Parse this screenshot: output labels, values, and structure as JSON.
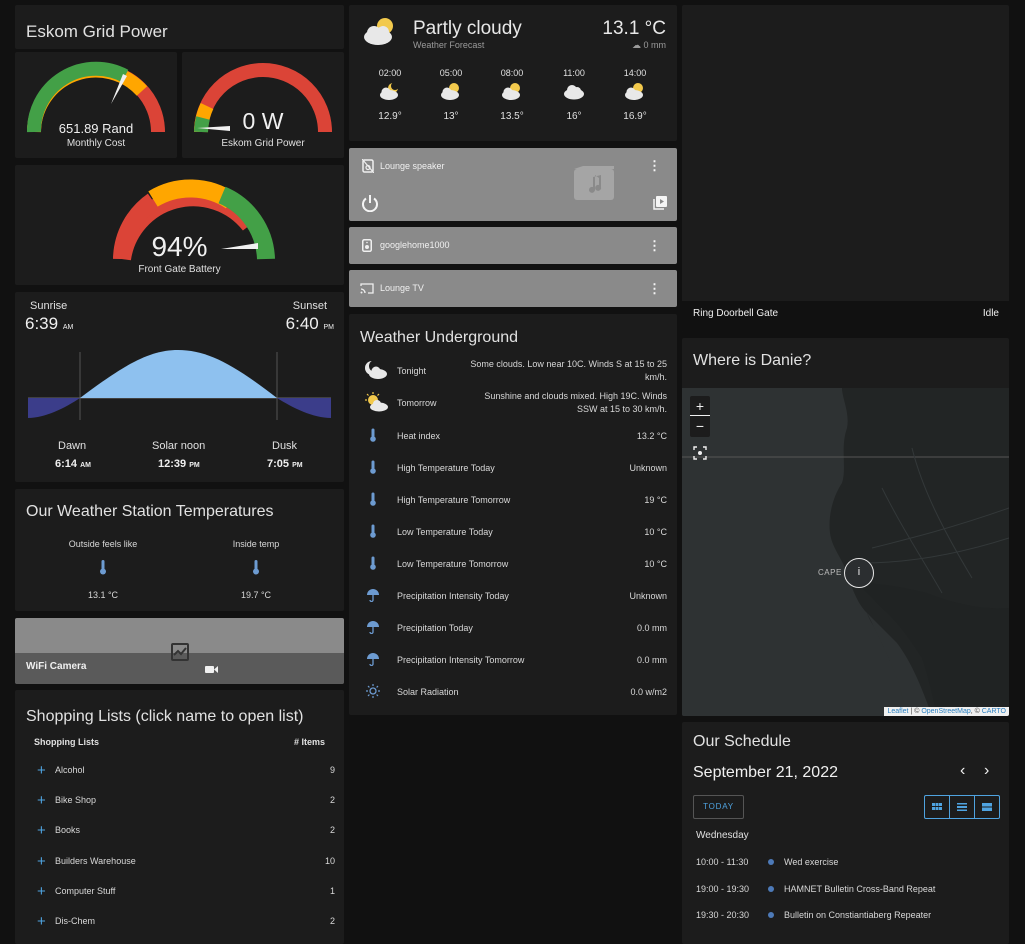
{
  "eskom": {
    "title": "Eskom Grid Power",
    "cost_value": "651.89 Rand",
    "cost_label": "Monthly Cost",
    "cost_level": 0.55,
    "power_value": "0 W",
    "power_label": "Eskom Grid Power",
    "power_level": 0.0,
    "battery_value": "94%",
    "battery_label": "Front Gate Battery",
    "battery_level": 0.94
  },
  "sun": {
    "sunrise_label": "Sunrise",
    "sunrise_time": "6:39",
    "sunrise_ampm": "AM",
    "sunset_label": "Sunset",
    "sunset_time": "6:40",
    "sunset_ampm": "PM",
    "dawn_label": "Dawn",
    "dawn_time": "6:14",
    "dawn_ampm": "AM",
    "noon_label": "Solar noon",
    "noon_time": "12:39",
    "noon_ampm": "PM",
    "dusk_label": "Dusk",
    "dusk_time": "7:05",
    "dusk_ampm": "PM"
  },
  "station": {
    "title": "Our Weather Station Temperatures",
    "items": [
      {
        "label": "Outside feels like",
        "value": "13.1 °C"
      },
      {
        "label": "Inside temp",
        "value": "19.7 °C"
      }
    ]
  },
  "camera": {
    "label": "WiFi Camera"
  },
  "shopping": {
    "title": "Shopping Lists (click name to open list)",
    "col_name": "Shopping Lists",
    "col_count": "# Items",
    "rows": [
      {
        "name": "Alcohol",
        "count": "9"
      },
      {
        "name": "Bike Shop",
        "count": "2"
      },
      {
        "name": "Books",
        "count": "2"
      },
      {
        "name": "Builders Warehouse",
        "count": "10"
      },
      {
        "name": "Computer Stuff",
        "count": "1"
      },
      {
        "name": "Dis-Chem",
        "count": "2"
      }
    ]
  },
  "forecast": {
    "condition": "Partly cloudy",
    "subtitle": "Weather Forecast",
    "temperature": "13.1 °C",
    "precip": "0 mm",
    "hours": [
      {
        "time": "02:00",
        "temp": "12.9°",
        "icon": "partly-cloudy-night-icon"
      },
      {
        "time": "05:00",
        "temp": "13°",
        "icon": "partly-cloudy-icon"
      },
      {
        "time": "08:00",
        "temp": "13.5°",
        "icon": "partly-cloudy-icon"
      },
      {
        "time": "11:00",
        "temp": "16°",
        "icon": "cloudy-icon"
      },
      {
        "time": "14:00",
        "temp": "16.9°",
        "icon": "partly-cloudy-icon"
      }
    ]
  },
  "media": {
    "lounge_speaker": "Lounge speaker",
    "googlehome": "googlehome1000",
    "lounge_tv": "Lounge TV"
  },
  "wu": {
    "title": "Weather Underground",
    "rows": [
      {
        "name": "Tonight",
        "value": "Some clouds. Low near 10C. Winds S at 15 to 25 km/h.",
        "icon": "night-cloud-icon"
      },
      {
        "name": "Tomorrow",
        "value": "Sunshine and clouds mixed. High 19C. Winds SSW at 15 to 30 km/h.",
        "icon": "partly-sunny-icon"
      },
      {
        "name": "Heat index",
        "value": "13.2 °C",
        "icon": "thermometer-icon"
      },
      {
        "name": "High Temperature Today",
        "value": "Unknown",
        "icon": "thermometer-icon"
      },
      {
        "name": "High Temperature Tomorrow",
        "value": "19 °C",
        "icon": "thermometer-icon"
      },
      {
        "name": "Low Temperature Today",
        "value": "10 °C",
        "icon": "thermometer-icon"
      },
      {
        "name": "Low Temperature Tomorrow",
        "value": "10 °C",
        "icon": "thermometer-icon"
      },
      {
        "name": "Precipitation Intensity Today",
        "value": "Unknown",
        "icon": "umbrella-icon"
      },
      {
        "name": "Precipitation Today",
        "value": "0.0 mm",
        "icon": "umbrella-icon"
      },
      {
        "name": "Precipitation Intensity Tomorrow",
        "value": "0.0 mm",
        "icon": "umbrella-icon"
      },
      {
        "name": "Solar Radiation",
        "value": "0.0 w/m2",
        "icon": "sun-icon"
      }
    ]
  },
  "doorbell": {
    "name": "Ring Doorbell Gate",
    "state": "Idle"
  },
  "map": {
    "title": "Where is Danie?",
    "zoom_in": "+",
    "zoom_out": "−",
    "place": "CAPE",
    "marker": "i",
    "attr_leaflet": "Leaflet",
    "attr_sep1": " | © ",
    "attr_osm": "OpenStreetMap",
    "attr_sep2": ", © ",
    "attr_carto": "CARTO"
  },
  "schedule": {
    "title": "Our Schedule",
    "date": "September 21, 2022",
    "today_btn": "TODAY",
    "day": "Wednesday",
    "events": [
      {
        "time": "10:00 - 11:30",
        "name": "Wed exercise"
      },
      {
        "time": "19:00 - 19:30",
        "name": "HAMNET Bulletin Cross-Band Repeat"
      },
      {
        "time": "19:30 - 20:30",
        "name": "Bulletin on Constiantiaberg Repeater"
      }
    ]
  },
  "colors": {
    "accent": "#4fa3e0",
    "gauge_green": "#43a047",
    "gauge_amber": "#ffa600",
    "gauge_red": "#db4437",
    "card_bg": "#1c1c1c",
    "page_bg": "#111111"
  }
}
